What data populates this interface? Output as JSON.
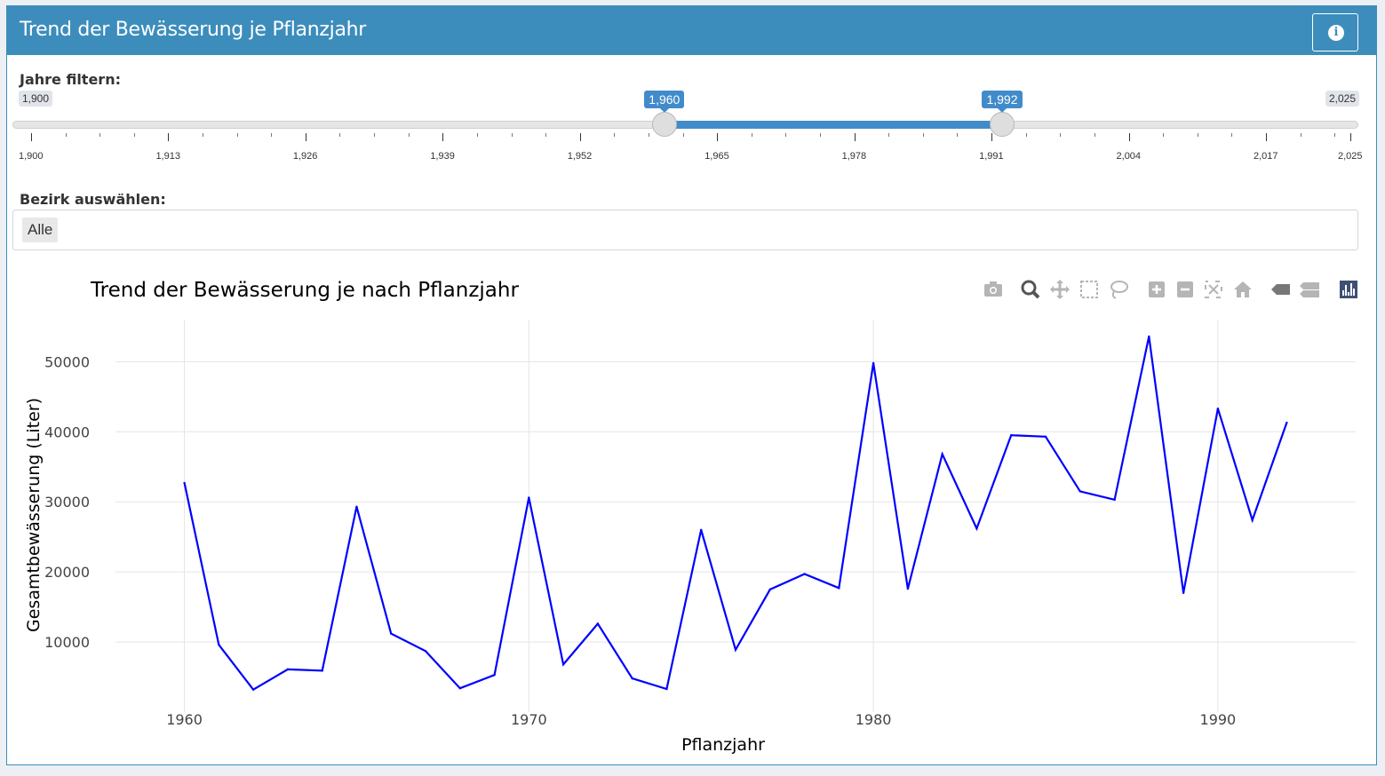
{
  "header": {
    "title": "Trend der Bewässerung je Pflanzjahr",
    "info_icon": "info-circle-icon"
  },
  "filter": {
    "label": "Jahre filtern:",
    "min_label": "1,900",
    "max_label": "2,025",
    "from_label": "1,960",
    "to_label": "1,992",
    "min": 1900,
    "max": 2025,
    "from": 1960,
    "to": 1992,
    "tick_labels": [
      "1,900",
      "1,913",
      "1,926",
      "1,939",
      "1,952",
      "1,965",
      "1,978",
      "1,991",
      "2,004",
      "2,017",
      "2,025"
    ]
  },
  "district": {
    "label": "Bezirk auswählen:",
    "selected": "Alle"
  },
  "modebar": [
    "camera-icon",
    "zoom-icon",
    "pan-icon",
    "box-select-icon",
    "lasso-select-icon",
    "zoom-in-icon",
    "zoom-out-icon",
    "autoscale-icon",
    "reset-axes-icon",
    "hover-closest-icon",
    "hover-compare-icon",
    "plotly-logo-icon"
  ],
  "chart_data": {
    "type": "line",
    "title": "Trend der Bewässerung je nach Pflanzjahr",
    "xlabel": "Pflanzjahr",
    "ylabel": "Gesamtbewässerung (Liter)",
    "xlim": [
      1958,
      1994
    ],
    "ylim": [
      0,
      56000
    ],
    "xticks": [
      1960,
      1970,
      1980,
      1990
    ],
    "yticks": [
      10000,
      20000,
      30000,
      40000,
      50000
    ],
    "grid": true,
    "line_color": "#0000ff",
    "x": [
      1960,
      1961,
      1962,
      1963,
      1964,
      1965,
      1966,
      1967,
      1968,
      1969,
      1970,
      1971,
      1972,
      1973,
      1974,
      1975,
      1976,
      1977,
      1978,
      1979,
      1980,
      1981,
      1982,
      1983,
      1984,
      1985,
      1986,
      1987,
      1988,
      1989,
      1990,
      1991,
      1992
    ],
    "y": [
      32700,
      9600,
      3200,
      6100,
      5900,
      29300,
      11200,
      8700,
      3400,
      5300,
      30600,
      6800,
      12600,
      4800,
      3300,
      26000,
      8900,
      17500,
      19700,
      17700,
      49800,
      17600,
      36800,
      26200,
      39500,
      39300,
      31500,
      30300,
      53600,
      17000,
      43300,
      27400,
      41300
    ]
  }
}
